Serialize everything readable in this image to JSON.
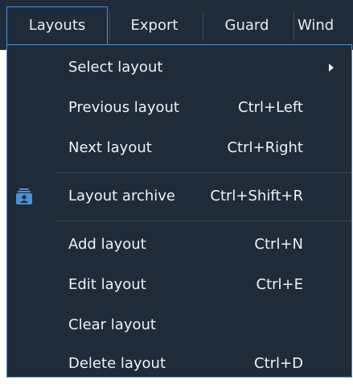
{
  "menubar": {
    "tabs": [
      {
        "label": "Layouts"
      },
      {
        "label": "Export"
      },
      {
        "label": "Guard"
      },
      {
        "label": "Wind"
      }
    ]
  },
  "dropdown": {
    "items": [
      {
        "label": "Select layout",
        "shortcut": "",
        "submenu": true
      },
      {
        "label": "Previous layout",
        "shortcut": "Ctrl+Left"
      },
      {
        "label": "Next layout",
        "shortcut": "Ctrl+Right"
      },
      {
        "label": "Layout archive",
        "shortcut": "Ctrl+Shift+R",
        "icon": "archive-icon"
      },
      {
        "label": "Add layout",
        "shortcut": "Ctrl+N"
      },
      {
        "label": "Edit layout",
        "shortcut": "Ctrl+E"
      },
      {
        "label": "Clear layout",
        "shortcut": ""
      },
      {
        "label": "Delete layout",
        "shortcut": "Ctrl+D"
      }
    ]
  },
  "colors": {
    "background": "#1f2b38",
    "accent": "#4a90d9",
    "text": "#eef2f6",
    "separator": "#3d4b5b"
  }
}
